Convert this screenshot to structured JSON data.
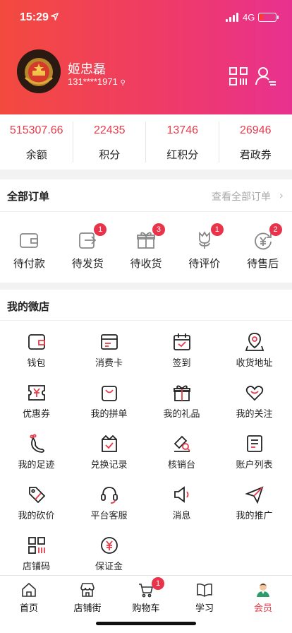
{
  "status_bar": {
    "time": "15:29",
    "network": "4G"
  },
  "profile": {
    "name": "姬忠磊",
    "phone": "131****1971"
  },
  "stats": [
    {
      "value": "515307.66",
      "label": "余额"
    },
    {
      "value": "22435",
      "label": "积分"
    },
    {
      "value": "13746",
      "label": "红积分"
    },
    {
      "value": "26946",
      "label": "君政券"
    }
  ],
  "orders": {
    "title": "全部订单",
    "view_all": "查看全部订单",
    "items": [
      {
        "label": "待付款",
        "icon": "wallet-icon",
        "badge": ""
      },
      {
        "label": "待发货",
        "icon": "ship-icon",
        "badge": "1"
      },
      {
        "label": "待收货",
        "icon": "gift-box-icon",
        "badge": "3"
      },
      {
        "label": "待评价",
        "icon": "flower-icon",
        "badge": "1"
      },
      {
        "label": "待售后",
        "icon": "refund-icon",
        "badge": "2"
      }
    ]
  },
  "shop": {
    "title": "我的微店",
    "items": [
      {
        "label": "钱包",
        "icon": "wallet-icon"
      },
      {
        "label": "消费卡",
        "icon": "card-icon"
      },
      {
        "label": "签到",
        "icon": "calendar-check-icon"
      },
      {
        "label": "收货地址",
        "icon": "location-icon"
      },
      {
        "label": "优惠券",
        "icon": "coupon-icon"
      },
      {
        "label": "我的拼单",
        "icon": "bag-icon"
      },
      {
        "label": "我的礼品",
        "icon": "gift-icon"
      },
      {
        "label": "我的关注",
        "icon": "heart-icon"
      },
      {
        "label": "我的足迹",
        "icon": "footprint-icon"
      },
      {
        "label": "兑换记录",
        "icon": "exchange-icon"
      },
      {
        "label": "核销台",
        "icon": "verify-icon"
      },
      {
        "label": "账户列表",
        "icon": "list-icon"
      },
      {
        "label": "我的砍价",
        "icon": "tag-icon"
      },
      {
        "label": "平台客服",
        "icon": "headset-icon"
      },
      {
        "label": "消息",
        "icon": "speaker-icon"
      },
      {
        "label": "我的推广",
        "icon": "send-icon"
      },
      {
        "label": "店铺码",
        "icon": "qr-code-icon"
      },
      {
        "label": "保证金",
        "icon": "deposit-icon"
      }
    ]
  },
  "tabbar": [
    {
      "label": "首页",
      "icon": "home-icon",
      "active": false
    },
    {
      "label": "店铺街",
      "icon": "store-icon",
      "active": false
    },
    {
      "label": "购物车",
      "icon": "cart-icon",
      "active": false,
      "badge": "1"
    },
    {
      "label": "学习",
      "icon": "book-icon",
      "active": false
    },
    {
      "label": "会员",
      "icon": "member-icon",
      "active": true
    }
  ],
  "colors": {
    "accent": "#e53b4a",
    "header_start": "#f34a3e",
    "header_end": "#e8318f",
    "badge": "#e8334a"
  }
}
